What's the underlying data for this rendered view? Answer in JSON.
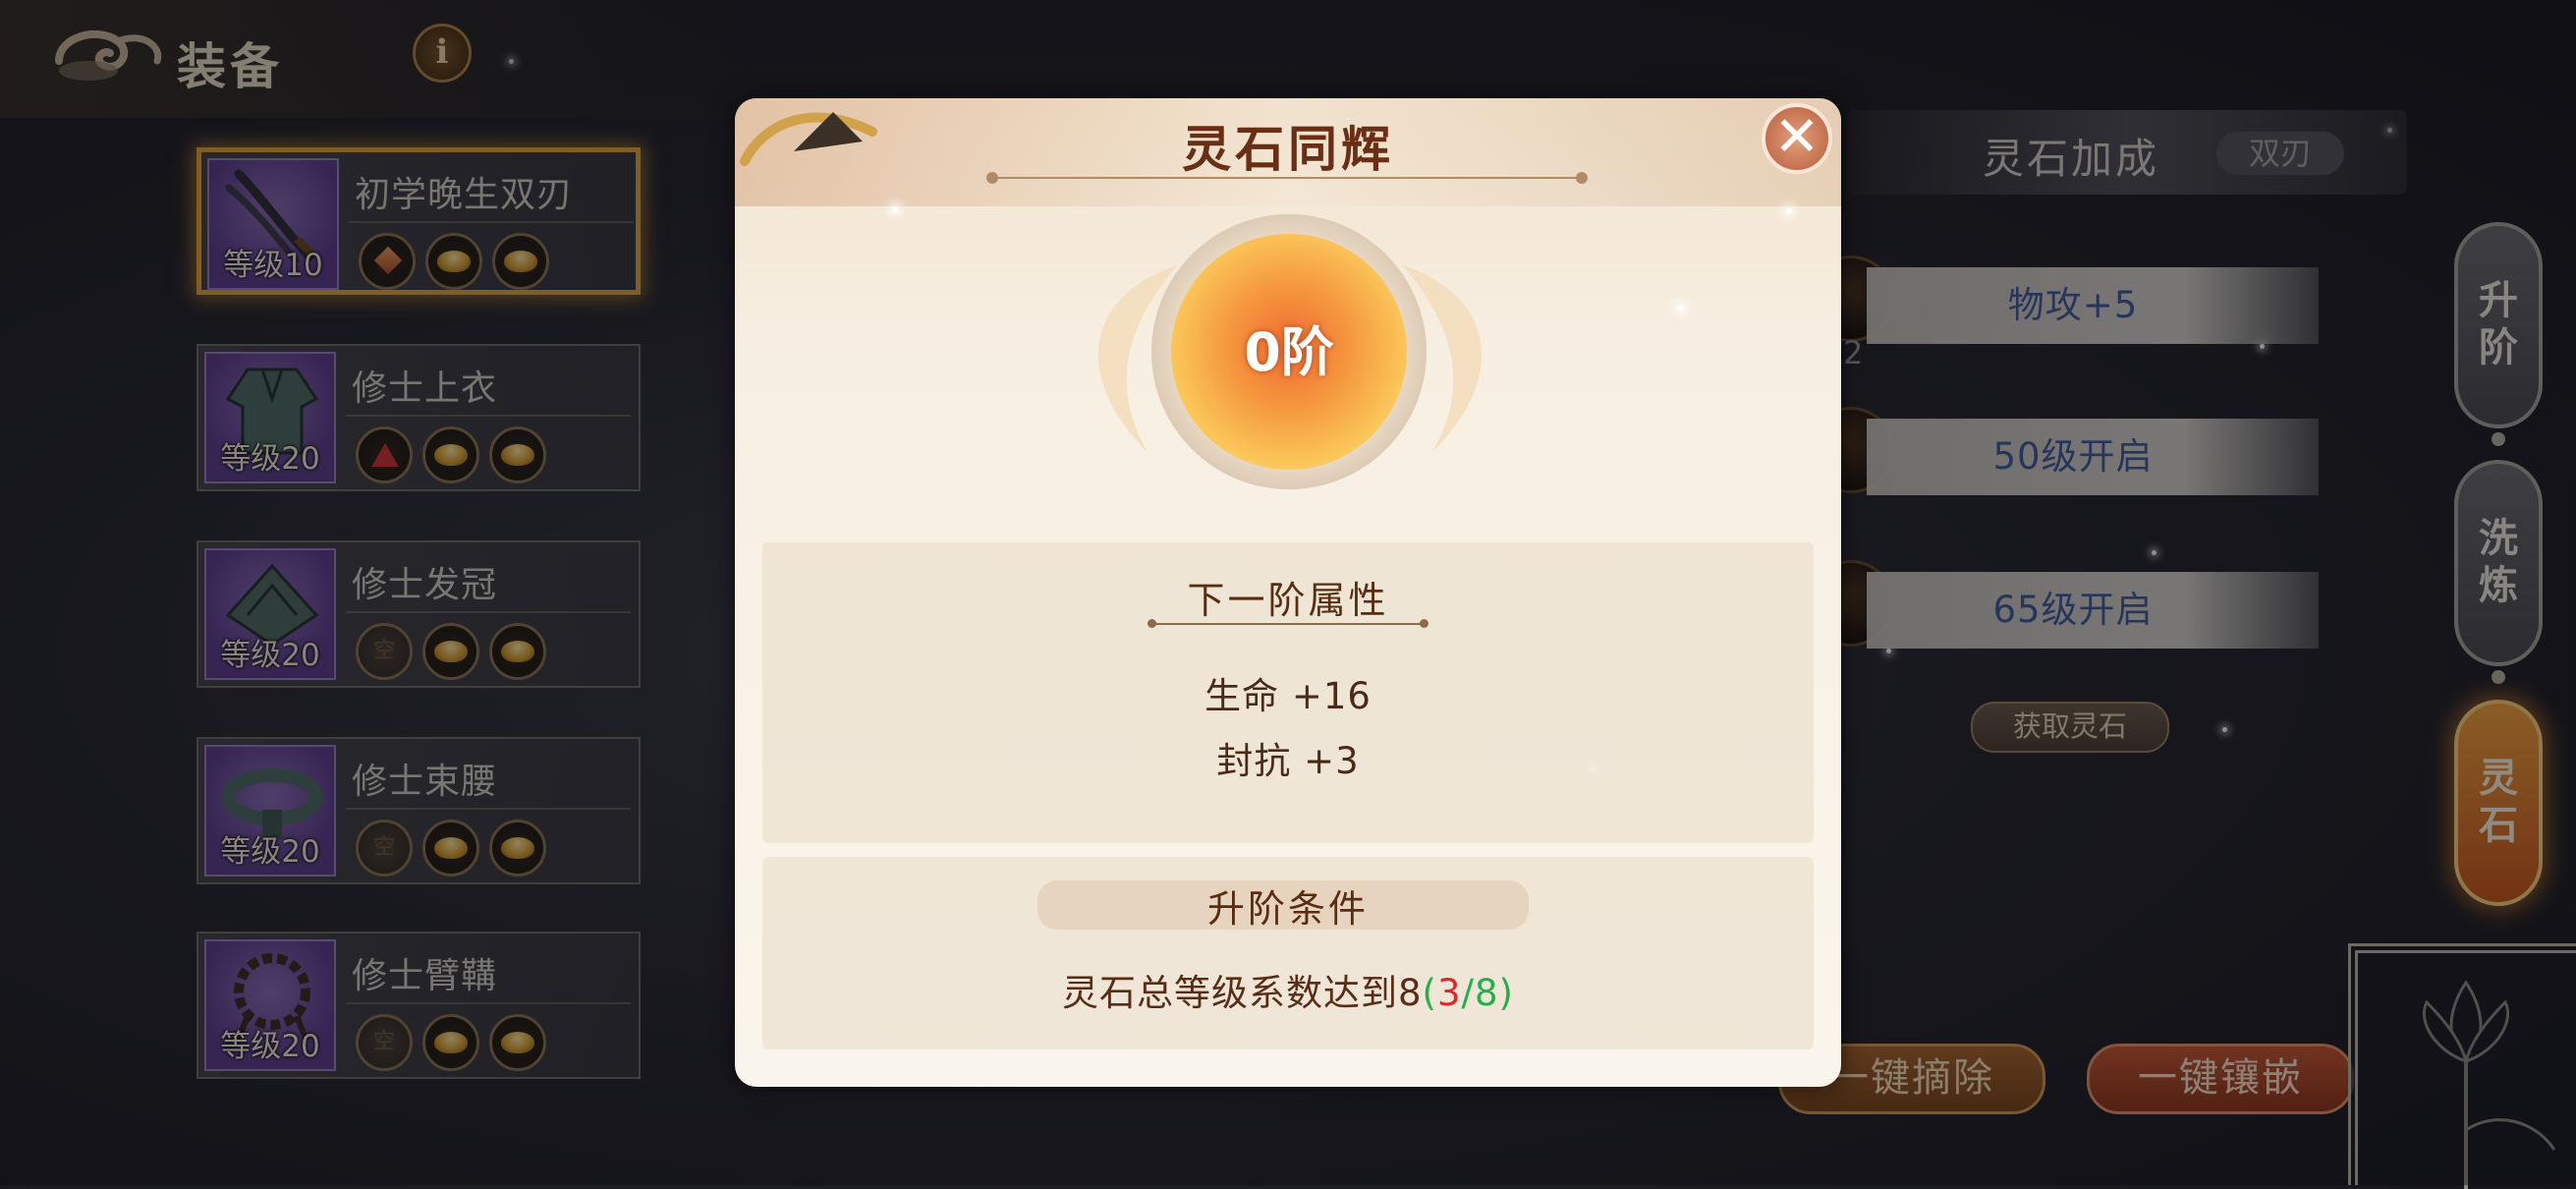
{
  "header": {
    "title": "装备",
    "info_icon": "info-icon",
    "info_glyph": "i"
  },
  "equipment": [
    {
      "name": "初学晚生双刃",
      "level": "等级10",
      "selected": true,
      "slots": [
        "diamond",
        "gold",
        "gold"
      ]
    },
    {
      "name": "修士上衣",
      "level": "等级20",
      "selected": false,
      "slots": [
        "triangle",
        "gold",
        "gold"
      ]
    },
    {
      "name": "修士发冠",
      "level": "等级20",
      "selected": false,
      "slots": [
        "empty",
        "gold",
        "gold"
      ]
    },
    {
      "name": "修士束腰",
      "level": "等级20",
      "selected": false,
      "slots": [
        "empty",
        "gold",
        "gold"
      ]
    },
    {
      "name": "修士臂鞲",
      "level": "等级20",
      "selected": false,
      "slots": [
        "empty",
        "gold",
        "gold"
      ]
    }
  ],
  "slot_empty_label": "空",
  "right_panel": {
    "title": "灵石加成",
    "tag": "双刃",
    "bonuses": [
      "物攻+5",
      "50级开启",
      "65级开启"
    ],
    "partial_count": "2",
    "get_stone_label": "获取灵石",
    "remove_all_label": "一键摘除",
    "inlay_all_label": "一键镶嵌"
  },
  "side_tabs": [
    {
      "label": [
        "升",
        "阶"
      ],
      "active": false
    },
    {
      "label": [
        "洗",
        "炼"
      ],
      "active": false
    },
    {
      "label": [
        "灵",
        "石"
      ],
      "active": true
    }
  ],
  "modal": {
    "title": "灵石同辉",
    "close_glyph": "✕",
    "rank": "0阶",
    "next_attr_title": "下一阶属性",
    "attributes": [
      "生命 +16",
      "封抗 +3"
    ],
    "condition_title": "升阶条件",
    "condition_text": "灵石总等级系数达到8",
    "condition_open": "(",
    "condition_current": "3",
    "condition_slash": "/",
    "condition_target": "8",
    "condition_close": ")"
  },
  "colors": {
    "accent_gold": "#e0a43a",
    "title_brown": "#6a2e14",
    "bonus_blue": "#3e5a9c",
    "progress_green": "#22b04a",
    "progress_red": "#e02626"
  }
}
